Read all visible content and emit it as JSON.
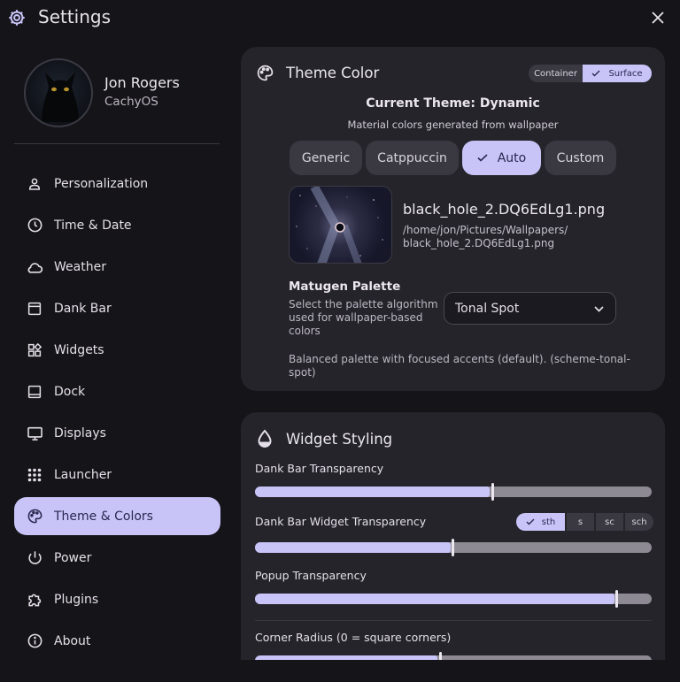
{
  "header": {
    "title": "Settings",
    "icon": "gear-icon",
    "close_icon": "close-icon"
  },
  "user": {
    "name": "Jon Rogers",
    "os": "CachyOS"
  },
  "sidebar": {
    "items": [
      {
        "label": "Personalization",
        "icon": "person-icon"
      },
      {
        "label": "Time & Date",
        "icon": "clock-icon"
      },
      {
        "label": "Weather",
        "icon": "cloud-icon"
      },
      {
        "label": "Dank Bar",
        "icon": "window-icon"
      },
      {
        "label": "Widgets",
        "icon": "widgets-icon"
      },
      {
        "label": "Dock",
        "icon": "dock-icon"
      },
      {
        "label": "Displays",
        "icon": "monitor-icon"
      },
      {
        "label": "Launcher",
        "icon": "apps-grid-icon"
      },
      {
        "label": "Theme & Colors",
        "icon": "palette-icon",
        "active": true
      },
      {
        "label": "Power",
        "icon": "power-icon"
      },
      {
        "label": "Plugins",
        "icon": "puzzle-icon"
      },
      {
        "label": "About",
        "icon": "info-icon"
      }
    ]
  },
  "theme_card": {
    "title": "Theme Color",
    "icon": "palette-icon",
    "toggle": {
      "container": "Container",
      "surface": "Surface",
      "selected": "Surface"
    },
    "current_theme": "Current Theme: Dynamic",
    "description": "Material colors generated from wallpaper",
    "tabs": [
      "Generic",
      "Catppuccin",
      "Auto",
      "Custom"
    ],
    "selected_tab": "Auto",
    "wallpaper": {
      "filename": "black_hole_2.DQ6EdLg1.png",
      "path_line1": "/home/jon/Pictures/Wallpapers/",
      "path_line2": "black_hole_2.DQ6EdLg1.png"
    },
    "matugen": {
      "title": "Matugen Palette",
      "desc_line1": "Select the palette algorithm",
      "desc_line2": "used for wallpaper-based",
      "desc_line3": "colors",
      "selected": "Tonal Spot",
      "note_line1": "Balanced palette with focused accents (default). (scheme-tonal-",
      "note_line2": "spot)"
    }
  },
  "widget_card": {
    "title": "Widget Styling",
    "icon": "drop-icon",
    "sliders": [
      {
        "label": "Dank Bar Transparency",
        "value": 0.6
      },
      {
        "label": "Dank Bar Widget Transparency",
        "value": 0.5
      },
      {
        "label": "Popup Transparency",
        "value": 0.92
      },
      {
        "label": "Corner Radius (0 = square corners)",
        "value": 0.47
      }
    ],
    "widget_modes": [
      "sth",
      "s",
      "sc",
      "sch"
    ],
    "widget_mode_selected": "sth"
  },
  "colors": {
    "accent": "#c8c4f8",
    "background": "#151419",
    "card": "#25242b"
  }
}
